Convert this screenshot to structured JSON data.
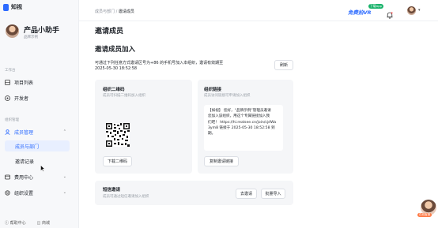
{
  "app": {
    "name": "知视",
    "brand_color": "#2d6bff"
  },
  "user": {
    "name": "产品小助手",
    "subtitle": "品牌示例"
  },
  "sidebar": {
    "section_work": "工作台",
    "section_org": "组织管理",
    "items": [
      {
        "label": "项目列表",
        "icon": "grid-icon"
      },
      {
        "label": "开发者",
        "icon": "developer-icon"
      },
      {
        "label": "成员管理",
        "icon": "members-icon",
        "expanded": true
      },
      {
        "label": "成员与部门",
        "active": true
      },
      {
        "label": "邀请记录"
      },
      {
        "label": "费用中心",
        "icon": "billing-icon"
      },
      {
        "label": "组织设置",
        "icon": "settings-icon"
      }
    ],
    "footer": {
      "help": "帮助中心",
      "store": "商城"
    }
  },
  "topbar": {
    "breadcrumb_parent": "成员与部门",
    "breadcrumb_sep": "/",
    "breadcrumb_current": "邀请成员",
    "vr_link": "免费拍VR",
    "vr_badge": "下载App"
  },
  "page": {
    "title": "邀请成员",
    "card_title": "邀请成员加入",
    "description": "可通过下列任意方式邀请区号为+86 的手机号加入本组织，邀请有效期至",
    "expire_time": "2025-05-30 18:52:58",
    "refresh_button": "刷新",
    "qr_panel": {
      "title": "组织二维码",
      "subtitle": "成员可扫描二维码加入组织",
      "download_button": "下载二维码"
    },
    "link_panel": {
      "title": "组织链接",
      "subtitle": "成员访问链接可申请加入组织",
      "message_line1": "【如视】 您好，“品牌示例”管理员邀请",
      "message_line2": "您加入该组织，用这个专属链接加入我",
      "message_line3": "们吧！ https://hi.realsee.cn/join/cjdWa",
      "message_line4": "3ym8 链接于 2025-05-30 18:52:58 到",
      "message_line5": "期。",
      "copy_button": "复制邀请链接"
    },
    "sms_panel": {
      "title": "短信邀请",
      "subtitle": "成员可通过短信邀请加入组织",
      "invite_button": "去邀请",
      "import_button": "批量导入"
    }
  },
  "assistant": {
    "label": "在线客服"
  }
}
